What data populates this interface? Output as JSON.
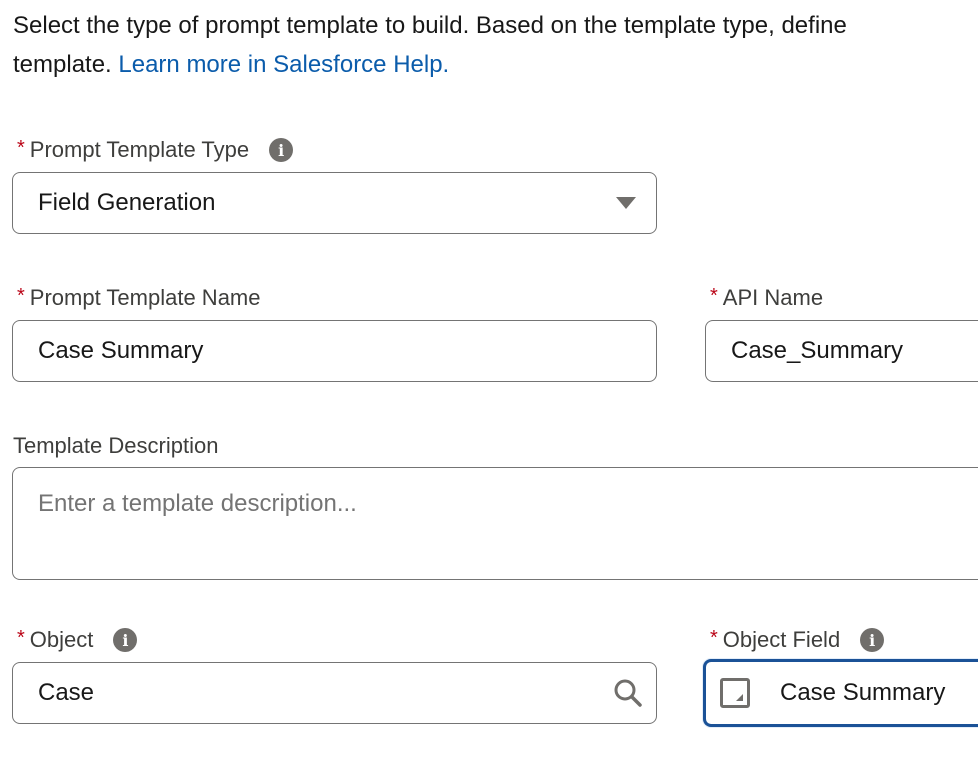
{
  "intro": {
    "line1": "Select the type of prompt template to build. Based on the template type, define",
    "line2_prefix": "template. ",
    "help_link": "Learn more in Salesforce Help."
  },
  "required_marker": "*",
  "info_glyph": "i",
  "prompt_template_type": {
    "label": "Prompt Template Type",
    "value": "Field Generation"
  },
  "prompt_template_name": {
    "label": "Prompt Template Name",
    "value": "Case Summary"
  },
  "api_name": {
    "label": "API Name",
    "value": "Case_Summary"
  },
  "template_description": {
    "label": "Template Description",
    "placeholder": "Enter a template description..."
  },
  "object": {
    "label": "Object",
    "value": "Case"
  },
  "object_field": {
    "label": "Object Field",
    "value": "Case Summary"
  },
  "colors": {
    "link": "#0b5cab",
    "required": "#ba0517",
    "focus_border": "#1b5297",
    "icon_gray": "#706e6b"
  },
  "icons": {
    "info": "info-icon",
    "dropdown": "chevron-down-icon",
    "search": "search-icon",
    "field_type": "text-area-field-icon"
  }
}
